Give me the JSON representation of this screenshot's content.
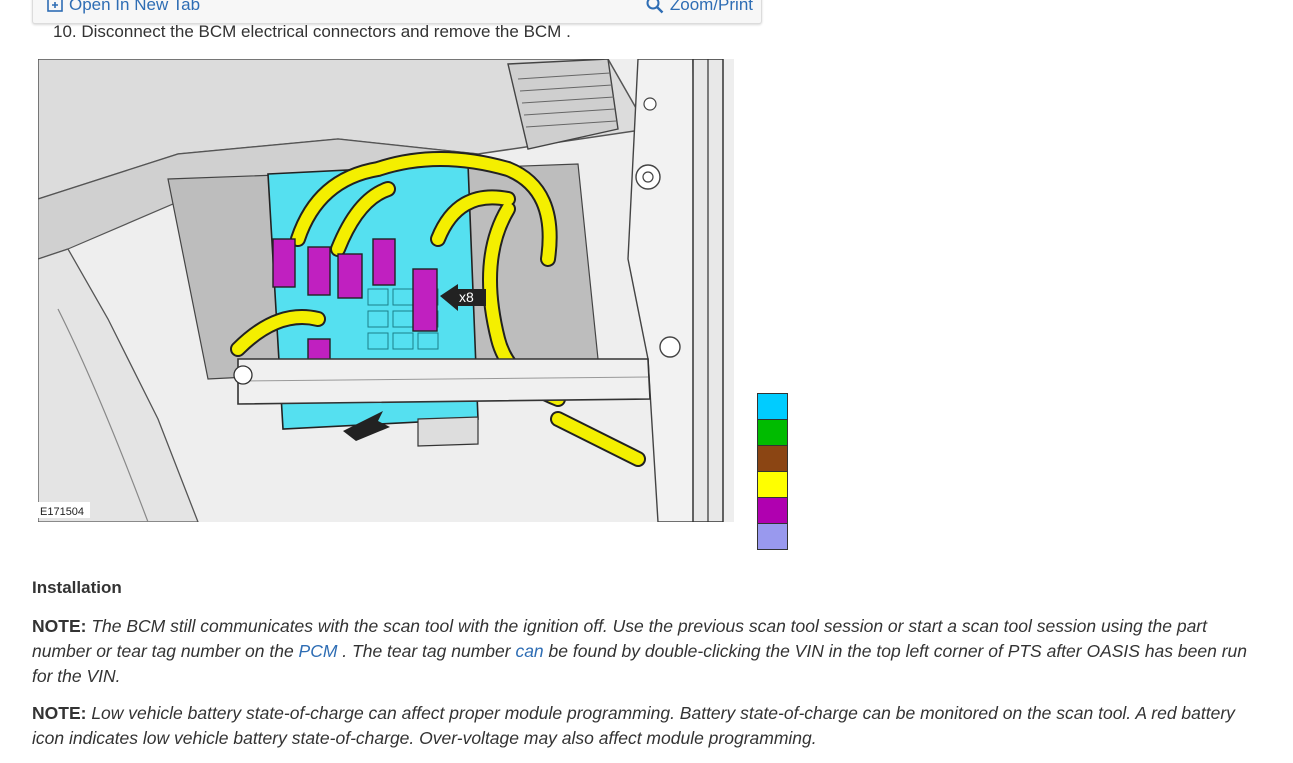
{
  "toolbar": {
    "open_label": "Open In New Tab",
    "zoom_label": "Zoom/Print"
  },
  "step": {
    "text": "10. Disconnect the BCM electrical connectors and remove the BCM ."
  },
  "figure": {
    "id_label": "E171504",
    "callout_label": "x8"
  },
  "legend": {
    "colors": [
      "#00ccff",
      "#00bb00",
      "#8b4513",
      "#ffff00",
      "#b000b0",
      "#9999ee"
    ]
  },
  "installation": {
    "title": "Installation",
    "note1": {
      "label": "NOTE:",
      "part1": " The BCM still communicates with the scan tool with the ignition off. Use the previous scan tool session or start a scan tool session using the part number or tear tag number on the ",
      "link1": "PCM",
      "part2": " . The tear tag number ",
      "link2": "can",
      "part3": " be found by double-clicking the VIN in the top left corner of PTS after OASIS has been run for the VIN."
    },
    "note2": {
      "label": "NOTE:",
      "text": " Low vehicle battery state-of-charge can affect proper module programming. Battery state-of-charge can be monitored on the scan tool. A red battery icon indicates low vehicle battery state-of-charge. Over-voltage may also affect module programming."
    }
  }
}
